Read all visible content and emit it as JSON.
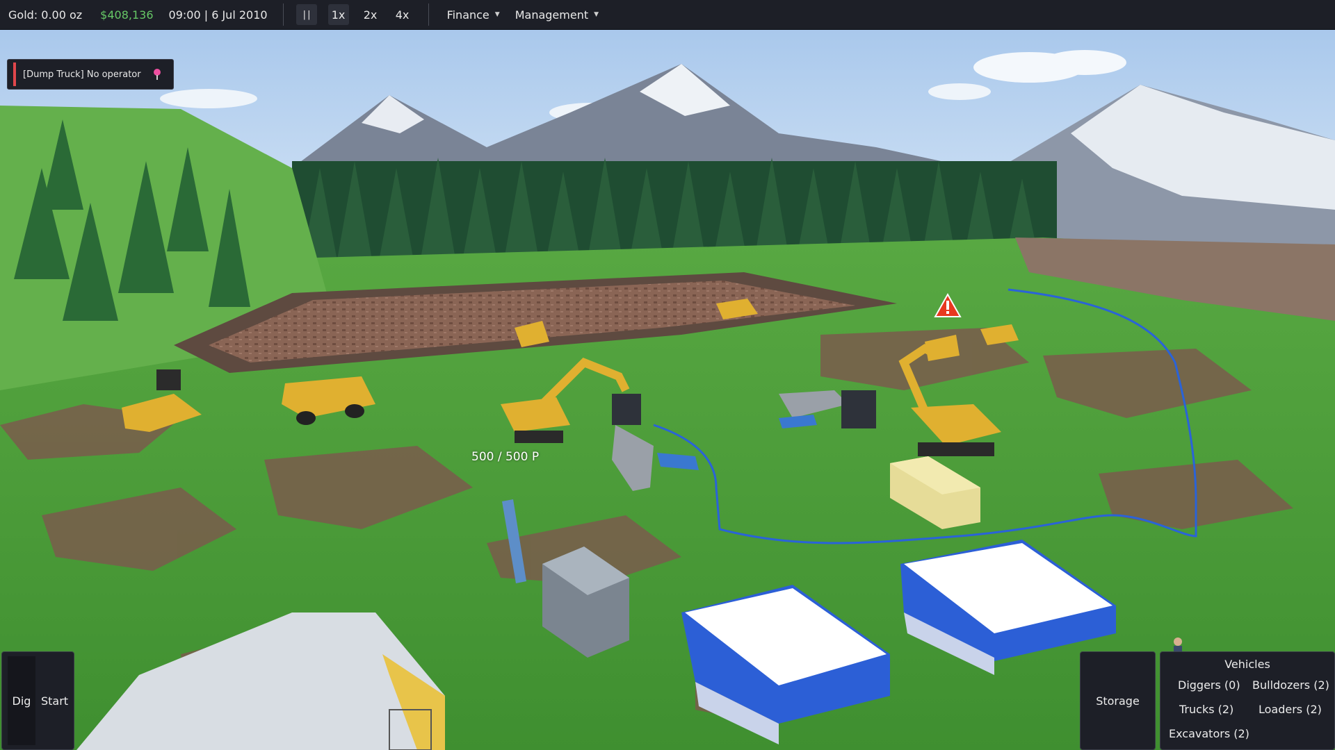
{
  "topbar": {
    "gold": "Gold: 0.00 oz",
    "money": "$408,136",
    "datetime": "09:00 | 6 Jul 2010",
    "pause_label": "| |",
    "speeds": [
      "1x",
      "2x",
      "4x"
    ],
    "menus": [
      "Finance",
      "Management"
    ],
    "caret": "▼"
  },
  "notification": {
    "text": "[Dump Truck] No operator"
  },
  "scene": {
    "capacity_label": "500 / 500 P",
    "colors": {
      "sky": "#b8d4f0",
      "grass": "#4a9a38",
      "dirt": "#7a5c4c",
      "machine_yellow": "#e0b030",
      "hose": "#2a63d8",
      "warning": "#e8391f"
    }
  },
  "bottom": {
    "dig_label": "Dig",
    "start_label": "Start",
    "storage_label": "Storage",
    "vehicles": {
      "title": "Vehicles",
      "diggers": "Diggers (0)",
      "bulldozers": "Bulldozers (2)",
      "trucks": "Trucks (2)",
      "loaders": "Loaders (2)",
      "excavators": "Excavators (2)"
    }
  }
}
